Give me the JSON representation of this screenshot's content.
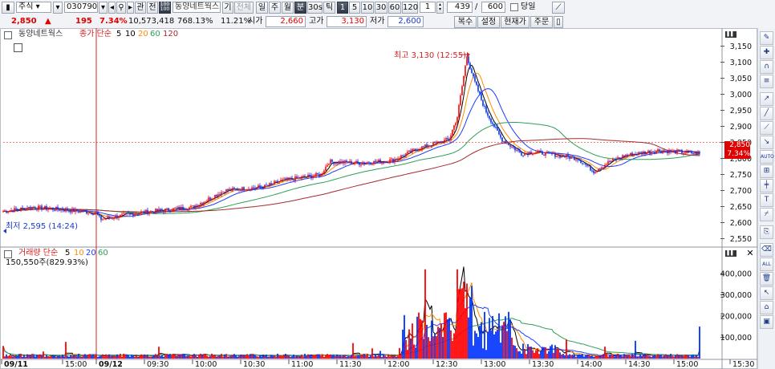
{
  "toolbar": {
    "market": "주식",
    "code": "030790",
    "search_icon": "search-icon",
    "btn_gwan": "관",
    "btn_jeon": "전",
    "btn_100a": "100",
    "btn_100b": "100",
    "name": "동양네트웍스",
    "btn_gi": "기",
    "btn_all": "전체",
    "periods": [
      "일",
      "주",
      "월",
      "분",
      "30s",
      "틱"
    ],
    "intervals": [
      "1",
      "5",
      "10",
      "30",
      "60",
      "120"
    ],
    "interval_value": "1",
    "count_value": "439",
    "count_sep": "/",
    "count_max": "600",
    "today_label": "당일"
  },
  "quote": {
    "price": "2,850",
    "arrow": "▲",
    "change": "195",
    "change_pct": "7.34%",
    "volume": "10,573,418",
    "vol_ratio": "768.13%",
    "turnover": "11.21%",
    "open_label": "시가",
    "open": "2,660",
    "high_label": "고가",
    "high": "3,130",
    "low_label": "저가",
    "low": "2,600",
    "btn_copy": "복수",
    "btn_setting": "설정",
    "btn_current": "현재가",
    "btn_order": "주문"
  },
  "price_panel": {
    "title": "동양네트웍스",
    "ma_label": "종가 단순",
    "ma_periods": [
      "5",
      "10",
      "20",
      "60",
      "120"
    ],
    "high_note": "최고 3,130 (12:55)",
    "low_note": "최저 2,595 (14:24)",
    "current_price": "2,850",
    "current_pct": "7.34%",
    "yticks": [
      "3,150",
      "3,100",
      "3,050",
      "3,000",
      "2,950",
      "2,900",
      "2,850",
      "2,800",
      "2,750",
      "2,700",
      "2,650",
      "2,600",
      "2,550"
    ]
  },
  "volume_panel": {
    "title": "거래량 단순",
    "ma_periods": [
      "5",
      "10",
      "20",
      "60"
    ],
    "value": "150,550주(829.93%)",
    "yticks": [
      "400,000",
      "300,000",
      "200,000",
      "100,000"
    ]
  },
  "xaxis": [
    "09/11",
    "15:00",
    "09/12",
    "09:30",
    "10:00",
    "10:30",
    "11:00",
    "11:30",
    "12:00",
    "12:30",
    "13:00",
    "13:30",
    "14:00",
    "14:30",
    "15:00",
    "15:30"
  ],
  "colors": {
    "up": "#ff0000",
    "down": "#0033ff",
    "ma5": "#000000",
    "ma10": "#ff8c00",
    "ma20": "#1e40ff",
    "ma60": "#2e9e55",
    "ma120": "#a52a2a"
  },
  "right_tools": [
    "pointer-icon",
    "crosshair-icon",
    "magnet-icon",
    "fibo-icon",
    "arrow-icon",
    "line-icon",
    "channel-icon",
    "auto-icon",
    "zoom-icon",
    "hline-icon",
    "text-icon",
    "period-icon",
    "ruler-icon",
    "eraser-icon",
    "all-icon",
    "trash-icon",
    "cursor-icon",
    "lock-icon",
    "capture-icon"
  ]
}
